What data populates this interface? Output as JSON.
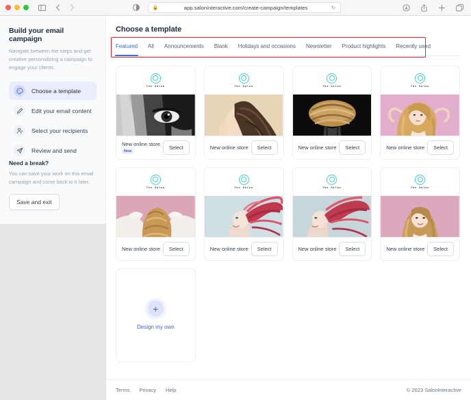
{
  "browser": {
    "url": "app.saloninteractive.com/create-campaign/templates",
    "lock_icon": "lock-icon",
    "reload_icon": "reload-icon",
    "sidebar_toggle_icon": "sidebar-toggle-icon",
    "back_icon": "back-arrow-icon",
    "forward_icon": "forward-arrow-icon",
    "reader_icon": "reader-mode-icon",
    "downloads_icon": "downloads-icon",
    "share_icon": "share-icon",
    "new_tab_icon": "new-tab-icon",
    "tab_overview_icon": "tab-overview-icon"
  },
  "sidebar": {
    "title": "Build your email campaign",
    "description": "Navigate between the steps and get creative personalizing a campaign to engage your clients.",
    "items": [
      {
        "label": "Choose a template",
        "icon": "palette-icon",
        "active": true
      },
      {
        "label": "Edit your email content",
        "icon": "pencil-icon",
        "active": false
      },
      {
        "label": "Select your recipients",
        "icon": "person-icon",
        "active": false
      },
      {
        "label": "Review and send",
        "icon": "paper-plane-icon",
        "active": false
      }
    ],
    "break": {
      "title": "Need a break?",
      "description": "You can save your work on this email campaign and come back to it later.",
      "button": "Save and exit"
    }
  },
  "main": {
    "page_title": "Choose a template",
    "tabs": [
      {
        "label": "Featured",
        "active": true
      },
      {
        "label": "All",
        "active": false
      },
      {
        "label": "Announcements",
        "active": false
      },
      {
        "label": "Blank",
        "active": false
      },
      {
        "label": "Holidays and occasions",
        "active": false
      },
      {
        "label": "Newsletter",
        "active": false
      },
      {
        "label": "Product highlights",
        "active": false
      },
      {
        "label": "Recently used",
        "active": false
      }
    ],
    "highlight_color": "#ee1c25",
    "accent_color": "#2f6fe0",
    "brand_name": "The Salon",
    "templates": [
      {
        "title": "New online store",
        "select_label": "Select",
        "badge": "New",
        "art": "bw-portrait-eye"
      },
      {
        "title": "New online store",
        "select_label": "Select",
        "badge": "",
        "art": "beige-long-curls"
      },
      {
        "title": "New online store",
        "select_label": "Select",
        "badge": "",
        "art": "black-swirl-hair"
      },
      {
        "title": "New online store",
        "select_label": "Select",
        "badge": "",
        "art": "pink-blonde-waves"
      },
      {
        "title": "New online store",
        "select_label": "Select",
        "badge": "",
        "art": "pink-back-of-head"
      },
      {
        "title": "New online store",
        "select_label": "Select",
        "badge": "",
        "art": "red-flying-hair"
      },
      {
        "title": "New online store",
        "select_label": "Select",
        "badge": "",
        "art": "red-flying-hair-2"
      },
      {
        "title": "New online store",
        "select_label": "Select",
        "badge": "",
        "art": "pink-curls-portrait"
      }
    ],
    "design_own": {
      "label": "Design my own",
      "icon": "plus-icon"
    }
  },
  "footer": {
    "links": [
      "Terms",
      "Privacy",
      "Help"
    ],
    "copyright": "© 2023 SalonInteractive"
  }
}
